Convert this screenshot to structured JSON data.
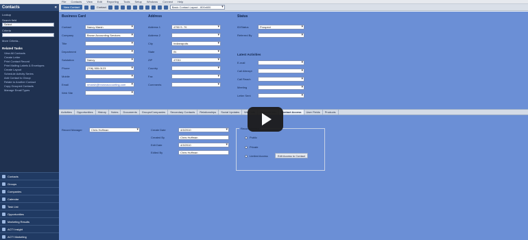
{
  "menu": [
    "File",
    "Contacts",
    "View",
    "Edit",
    "Reporting",
    "Tools",
    "Setup",
    "Windows",
    "Connect",
    "Help"
  ],
  "sidebar": {
    "title": "Contacts",
    "lookup_label": "Lookup",
    "search_field_label": "Search field",
    "search_field_value": "Select",
    "criteria_label": "Criteria",
    "more_link": "More Criteria...",
    "section_title": "Related Tasks",
    "tasks": [
      "View All Contacts",
      "Create Letter",
      "Print Contact Record",
      "Print Mailing Labels & Envelopes",
      "Create Layout",
      "Schedule Activity Series",
      "Add Contact to Group",
      "Relate to Another Contact",
      "Copy Grouped Contacts",
      "Manage Email Types"
    ],
    "nav": [
      "Contacts",
      "Groups",
      "Companies",
      "Calendar",
      "Task List",
      "Opportunities",
      "Marketing Results",
      "ACT! Insight",
      "ACT! Marketing"
    ]
  },
  "toolbar": {
    "new_button": "New Contact",
    "contact_label": "Contact",
    "layout_select": "Basic Contact Layout - 800x600"
  },
  "business_card": {
    "title": "Business Card",
    "fields": [
      {
        "label": "Contact",
        "value": "Nancy Marsh"
      },
      {
        "label": "Company",
        "value": "Brown Accounting Services"
      },
      {
        "label": "Title",
        "value": ""
      },
      {
        "label": "Department",
        "value": ""
      },
      {
        "label": "Salutation",
        "value": "Nancy"
      },
      {
        "label": "Phone",
        "value": "(706) 555-0123"
      },
      {
        "label": "Mobile",
        "value": ""
      },
      {
        "label": "Email",
        "value": "nmarsh@brownaccounting.com"
      },
      {
        "label": "Web Site",
        "value": ""
      }
    ]
  },
  "address": {
    "title": "Address",
    "fields": [
      {
        "label": "Address 1",
        "value": "4750 S. 70"
      },
      {
        "label": "Address 2",
        "value": ""
      },
      {
        "label": "City",
        "value": "Indianapolis"
      },
      {
        "label": "State",
        "value": "IN"
      },
      {
        "label": "ZIP",
        "value": "47011"
      },
      {
        "label": "Country",
        "value": ""
      },
      {
        "label": "Fax",
        "value": ""
      },
      {
        "label": "Comments",
        "value": ""
      }
    ]
  },
  "status": {
    "title": "Status",
    "fields": [
      {
        "label": "ID/Status",
        "value": "Prospect"
      },
      {
        "label": "Referred By",
        "value": ""
      }
    ],
    "last_results_title": "Latest Activities",
    "results": [
      {
        "label": "E-mail",
        "value": ""
      },
      {
        "label": "Call Attempt",
        "value": ""
      },
      {
        "label": "Call Reach",
        "value": ""
      },
      {
        "label": "Meeting",
        "value": ""
      },
      {
        "label": "Letter Sent",
        "value": ""
      }
    ]
  },
  "tabs": [
    "Activities",
    "Opportunities",
    "History",
    "Notes",
    "Documents",
    "Groups/Companies",
    "Secondary Contacts",
    "Relationships",
    "Social Updates",
    "Web Info",
    "Personal Info",
    "Contact Access",
    "User Fields",
    "Products"
  ],
  "active_tab": "Contact Access",
  "access": {
    "record_manager_label": "Record Manager",
    "record_manager_value": "Chris Huffman",
    "create_date_label": "Create Date",
    "create_date_value": "4/3/2010",
    "created_by_label": "Created By",
    "created_by_value": "Chris Huffman",
    "edit_date_label": "Edit Date",
    "edit_date_value": "4/3/2010",
    "edited_by_label": "Edited By",
    "edited_by_value": "Chris Huffman",
    "group_title": "Record Access",
    "option_public": "Public",
    "option_private": "Private",
    "option_limited": "Limited Access",
    "select_button": "Edit Access to Contact"
  },
  "colors": {
    "sidebar": "#1f3150",
    "content": "#6b8fd6",
    "accent": "#3d6aa8"
  }
}
